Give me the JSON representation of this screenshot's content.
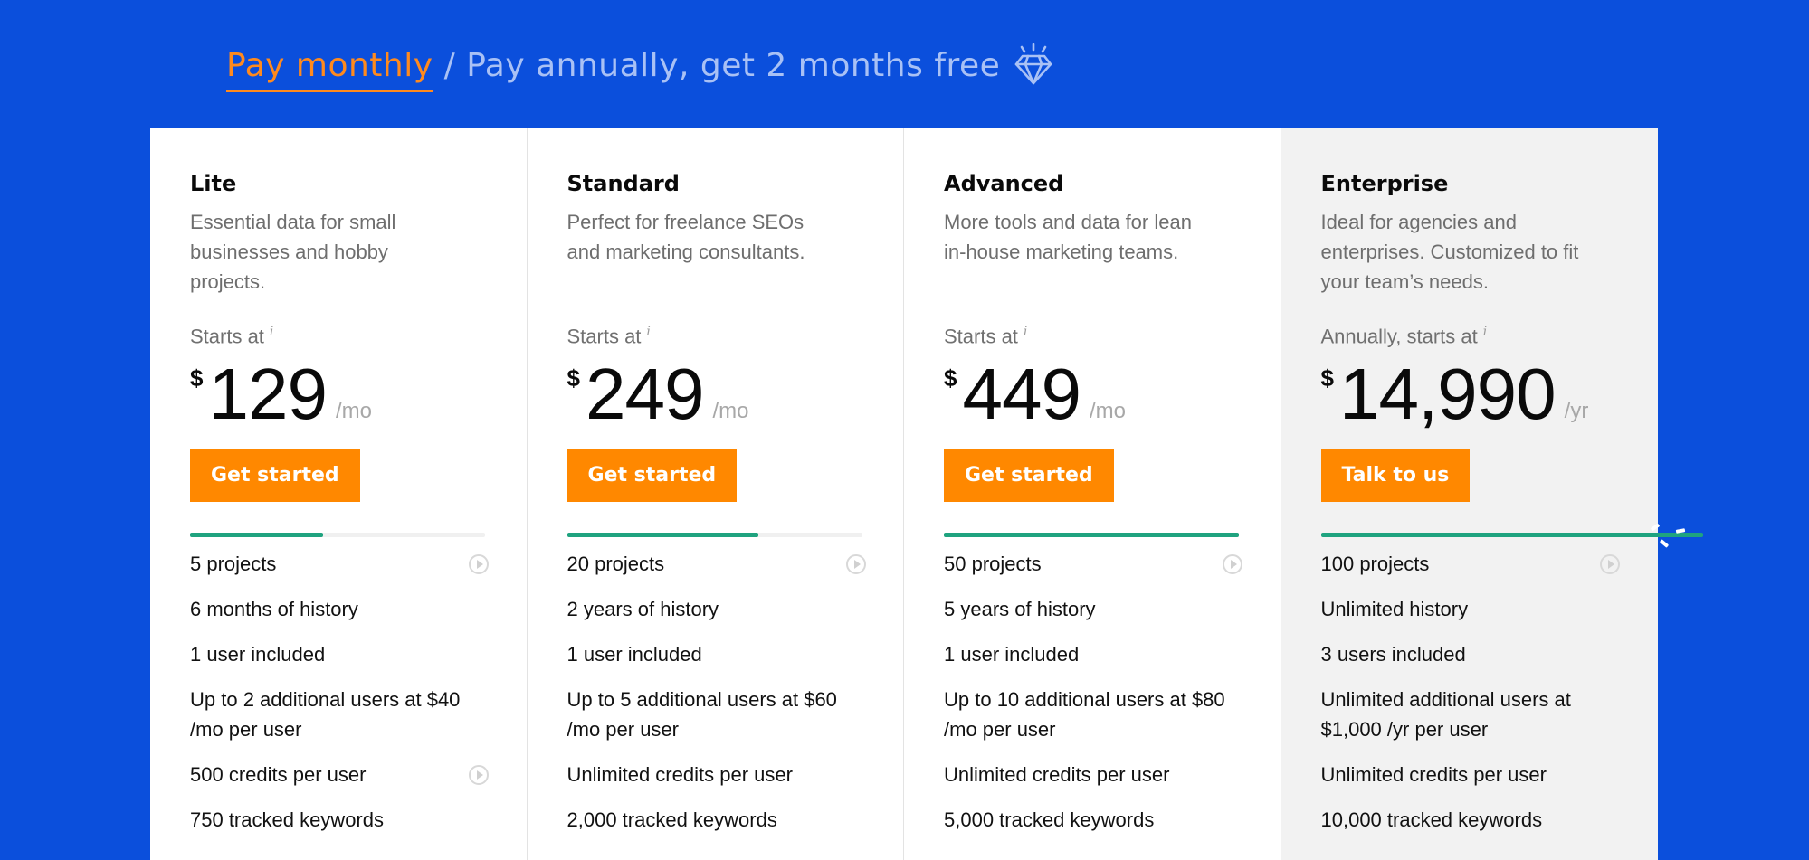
{
  "billing_toggle": {
    "monthly_label": "Pay monthly",
    "separator": "/",
    "annually_label": "Pay annually, get 2 months free",
    "selected": "monthly",
    "icon": "diamond-icon"
  },
  "colors": {
    "background": "#0b4fdc",
    "accent_orange": "#ff8800",
    "progress_green": "#1fa37f",
    "enterprise_bg": "#f2f2f2"
  },
  "plans": [
    {
      "name": "Lite",
      "description": "Essential data for small businesses and hobby projects.",
      "price_label": "Starts at",
      "info_icon": "i",
      "currency": "$",
      "price": "129",
      "period": "/mo",
      "cta": "Get started",
      "projects_progress_pct": 45,
      "features": [
        {
          "text": "5 projects",
          "has_video": true
        },
        {
          "text": "6 months of history",
          "has_video": false
        },
        {
          "text": "1 user included",
          "has_video": false
        },
        {
          "text": "Up to 2 additional users at $40 /mo per user",
          "has_video": false
        },
        {
          "text": "500 credits per user",
          "has_video": true
        },
        {
          "text": "750 tracked keywords",
          "has_video": false
        }
      ]
    },
    {
      "name": "Standard",
      "description": "Perfect for freelance SEOs and marketing consultants.",
      "price_label": "Starts at",
      "info_icon": "i",
      "currency": "$",
      "price": "249",
      "period": "/mo",
      "cta": "Get started",
      "projects_progress_pct": 65,
      "features": [
        {
          "text": "20 projects",
          "has_video": true
        },
        {
          "text": "2 years of history",
          "has_video": false
        },
        {
          "text": "1 user included",
          "has_video": false
        },
        {
          "text": "Up to 5 additional users at $60 /mo per user",
          "has_video": false
        },
        {
          "text": "Unlimited credits per user",
          "has_video": false
        },
        {
          "text": "2,000 tracked keywords",
          "has_video": false
        }
      ]
    },
    {
      "name": "Advanced",
      "description": "More tools and data for lean in-house marketing teams.",
      "price_label": "Starts at",
      "info_icon": "i",
      "currency": "$",
      "price": "449",
      "period": "/mo",
      "cta": "Get started",
      "projects_progress_pct": 100,
      "features": [
        {
          "text": "50 projects",
          "has_video": true
        },
        {
          "text": "5 years of history",
          "has_video": false
        },
        {
          "text": "1 user included",
          "has_video": false
        },
        {
          "text": "Up to 10 additional users at $80 /mo per user",
          "has_video": false
        },
        {
          "text": "Unlimited credits per user",
          "has_video": false
        },
        {
          "text": "5,000 tracked keywords",
          "has_video": false
        }
      ]
    },
    {
      "name": "Enterprise",
      "description": "Ideal for agencies and enterprises. Customized to fit your team’s needs.",
      "price_label": "Annually, starts at",
      "info_icon": "i",
      "currency": "$",
      "price": "14,990",
      "period": "/yr",
      "cta": "Talk to us",
      "projects_progress_pct": 100,
      "progress_overflow": true,
      "features": [
        {
          "text": "100 projects",
          "has_video": true
        },
        {
          "text": "Unlimited history",
          "has_video": false
        },
        {
          "text": "3 users included",
          "has_video": false
        },
        {
          "text": "Unlimited additional users at $1,000 /yr per user",
          "has_video": false
        },
        {
          "text": "Unlimited credits per user",
          "has_video": false
        },
        {
          "text": "10,000 tracked keywords",
          "has_video": false
        }
      ]
    }
  ]
}
